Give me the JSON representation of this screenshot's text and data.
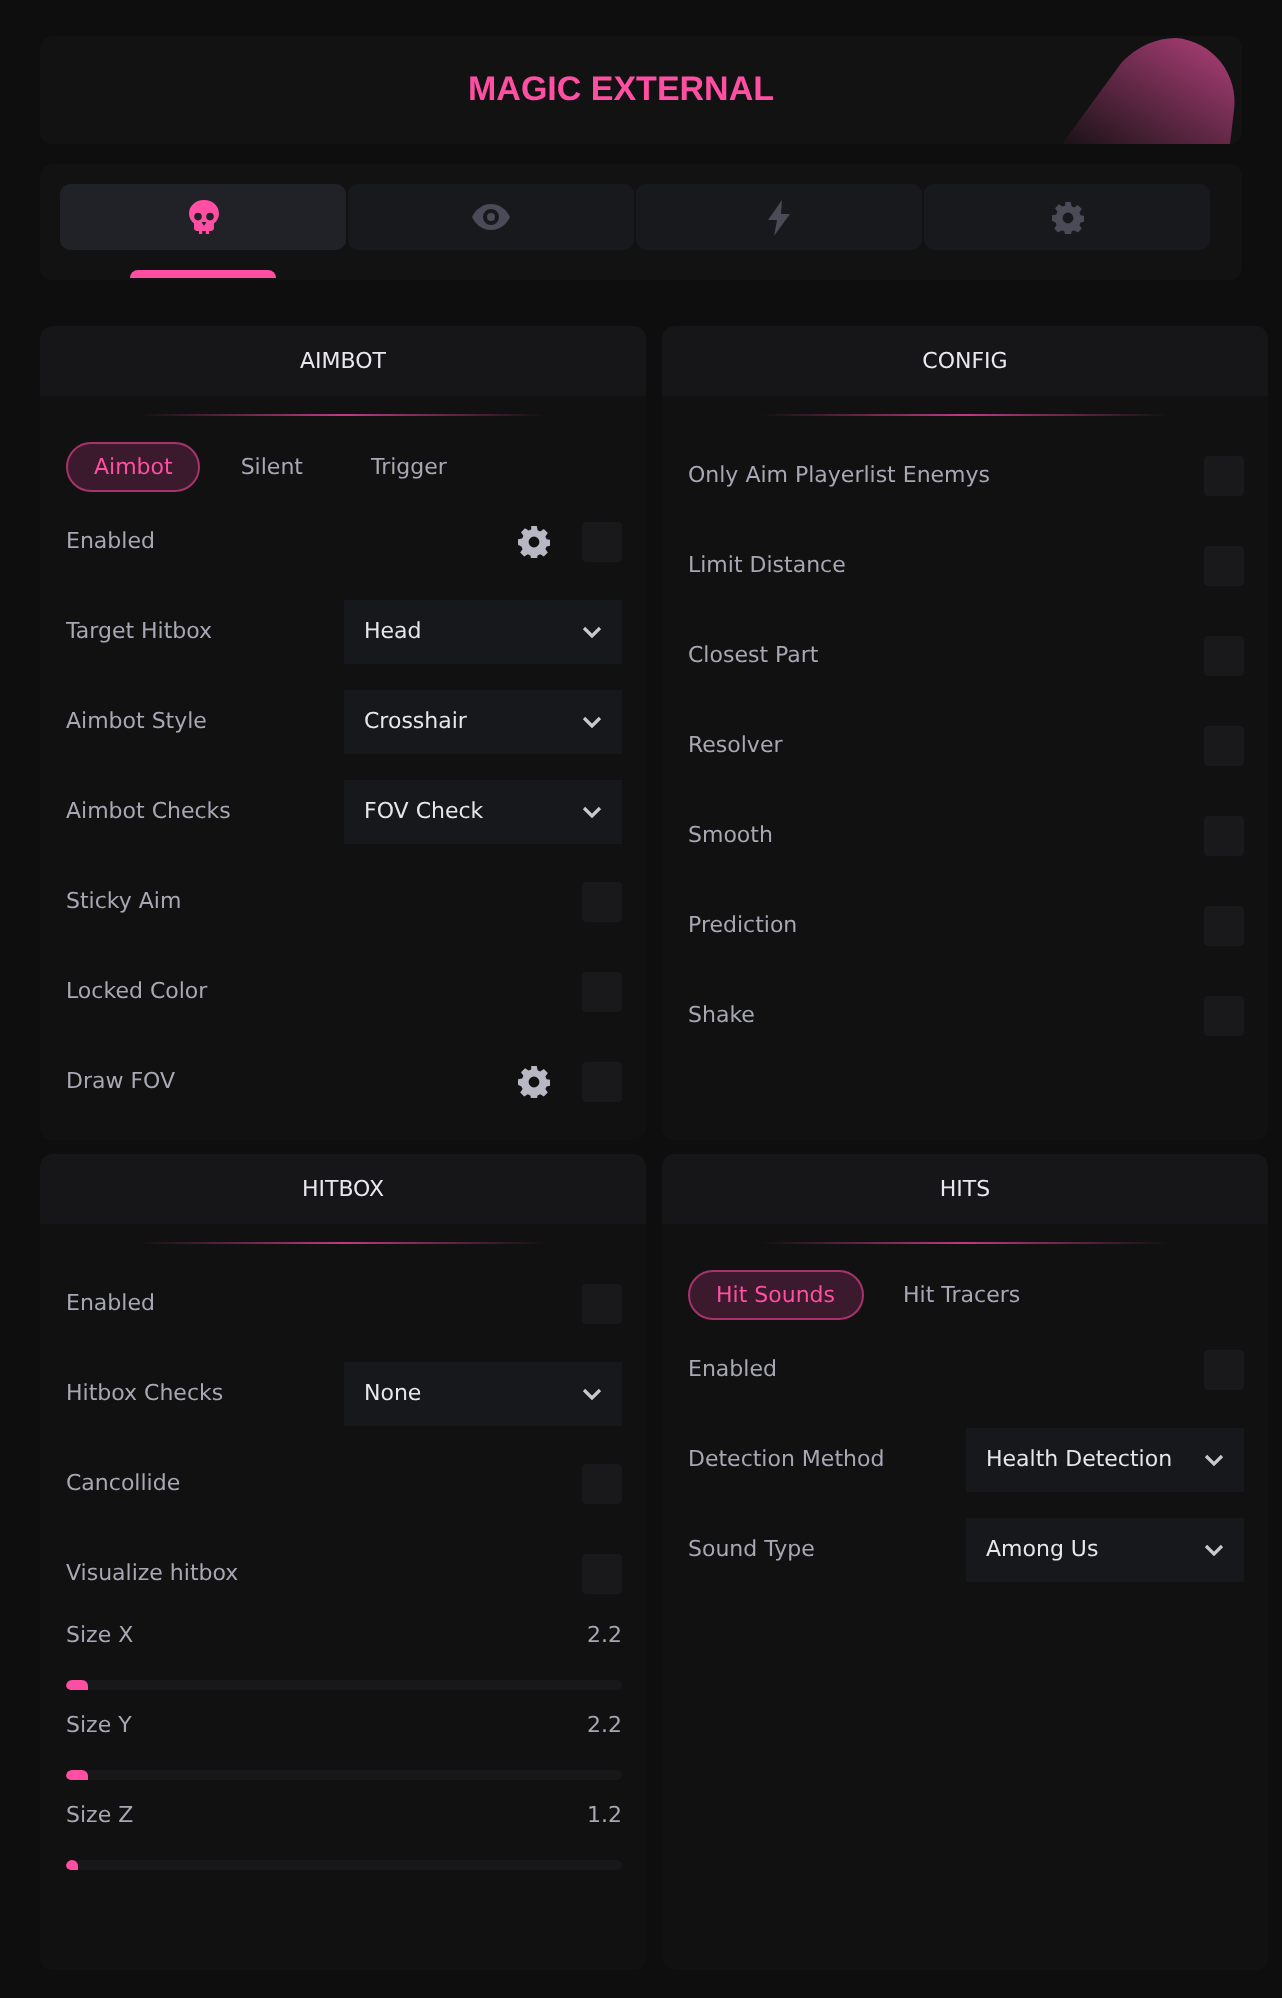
{
  "header": {
    "title": "MAGIC EXTERNAL"
  },
  "nav_tabs": [
    {
      "selected": true
    },
    {
      "selected": false
    },
    {
      "selected": false
    },
    {
      "selected": false
    }
  ],
  "panels": [
    {
      "title": "AIMBOT",
      "tabs": [
        {
          "label": "Aimbot",
          "selected": true
        },
        {
          "label": "Silent",
          "selected": false
        },
        {
          "label": "Trigger",
          "selected": false
        }
      ],
      "rows": [
        {
          "kind": "checkbox",
          "label": "Enabled",
          "settings": true,
          "checked": false
        },
        {
          "kind": "select",
          "label": "Target Hitbox",
          "value": "Head"
        },
        {
          "kind": "select",
          "label": "Aimbot Style",
          "value": "Crosshair"
        },
        {
          "kind": "select",
          "label": "Aimbot Checks",
          "value": "FOV Check"
        },
        {
          "kind": "checkbox",
          "label": "Sticky Aim",
          "settings": false,
          "checked": false
        },
        {
          "kind": "checkbox",
          "label": "Locked Color",
          "settings": false,
          "checked": false
        },
        {
          "kind": "checkbox",
          "label": "Draw FOV",
          "settings": true,
          "checked": false
        }
      ]
    },
    {
      "title": "CONFIG",
      "rows": [
        {
          "kind": "checkbox",
          "label": "Only Aim Playerlist Enemys",
          "settings": false,
          "checked": false
        },
        {
          "kind": "checkbox",
          "label": "Limit Distance",
          "settings": false,
          "checked": false
        },
        {
          "kind": "checkbox",
          "label": "Closest Part",
          "settings": false,
          "checked": false
        },
        {
          "kind": "checkbox",
          "label": "Resolver",
          "settings": false,
          "checked": false
        },
        {
          "kind": "checkbox",
          "label": "Smooth",
          "settings": false,
          "checked": false
        },
        {
          "kind": "checkbox",
          "label": "Prediction",
          "settings": false,
          "checked": false
        },
        {
          "kind": "checkbox",
          "label": "Shake",
          "settings": false,
          "checked": false
        }
      ]
    },
    {
      "title": "HITBOX",
      "rows": [
        {
          "kind": "checkbox",
          "label": "Enabled",
          "settings": false,
          "checked": false
        },
        {
          "kind": "select",
          "label": "Hitbox Checks",
          "value": "None"
        },
        {
          "kind": "checkbox",
          "label": "Cancollide",
          "settings": false,
          "checked": false
        },
        {
          "kind": "checkbox",
          "label": "Visualize hitbox",
          "settings": false,
          "checked": false
        },
        {
          "kind": "slider",
          "label": "Size X",
          "reading": "2.2",
          "level": 0.04
        },
        {
          "kind": "slider",
          "label": "Size Y",
          "reading": "2.2",
          "level": 0.04
        },
        {
          "kind": "slider",
          "label": "Size Z",
          "reading": "1.2",
          "level": 0.02
        }
      ]
    },
    {
      "title": "HITS",
      "tabs": [
        {
          "label": "Hit Sounds",
          "selected": true
        },
        {
          "label": "Hit Tracers",
          "selected": false
        }
      ],
      "rows": [
        {
          "kind": "checkbox",
          "label": "Enabled",
          "settings": false,
          "checked": false
        },
        {
          "kind": "select",
          "label": "Detection Method",
          "value": "Health Detection"
        },
        {
          "kind": "select",
          "label": "Sound Type",
          "value": "Among Us"
        }
      ]
    }
  ]
}
